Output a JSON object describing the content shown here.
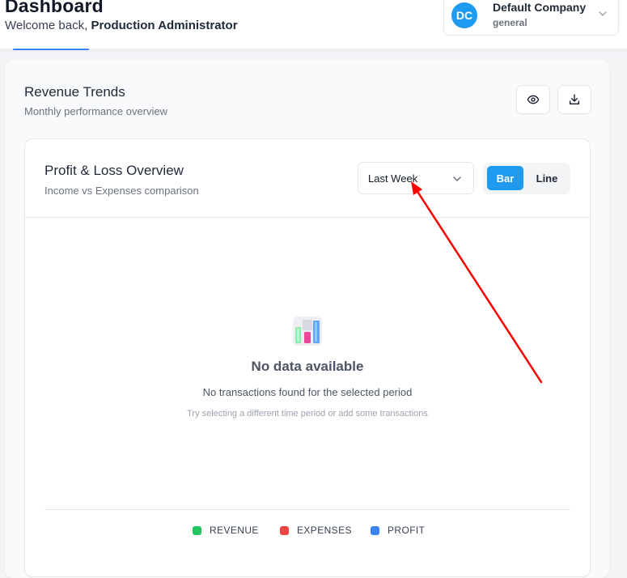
{
  "header": {
    "title": "Dashboard",
    "welcome_prefix": "Welcome back, ",
    "user_name": "Production Administrator"
  },
  "company": {
    "initials": "DC",
    "name": "Default Company",
    "sub": "general",
    "avatar_color": "#1e9af0"
  },
  "revenue_card": {
    "title": "Revenue Trends",
    "subtitle": "Monthly performance overview",
    "view_icon": "eye-icon",
    "download_icon": "download-icon"
  },
  "pl_panel": {
    "title": "Profit & Loss Overview",
    "subtitle": "Income vs Expenses comparison",
    "period_select": {
      "value": "Last Week"
    },
    "chart_type": {
      "options": [
        "Bar",
        "Line"
      ],
      "active": "Bar"
    },
    "accent": "#1e9af0"
  },
  "empty_state": {
    "icon": "bar-chart-icon",
    "title": "No data available",
    "message": "No transactions found for the selected period",
    "hint": "Try selecting a different time period or add some transactions"
  },
  "legend": [
    {
      "label": "REVENUE",
      "color": "#22c55e"
    },
    {
      "label": "EXPENSES",
      "color": "#ef4444"
    },
    {
      "label": "PROFIT",
      "color": "#3b82f6"
    }
  ],
  "annotation": {
    "color": "#ff0000"
  }
}
